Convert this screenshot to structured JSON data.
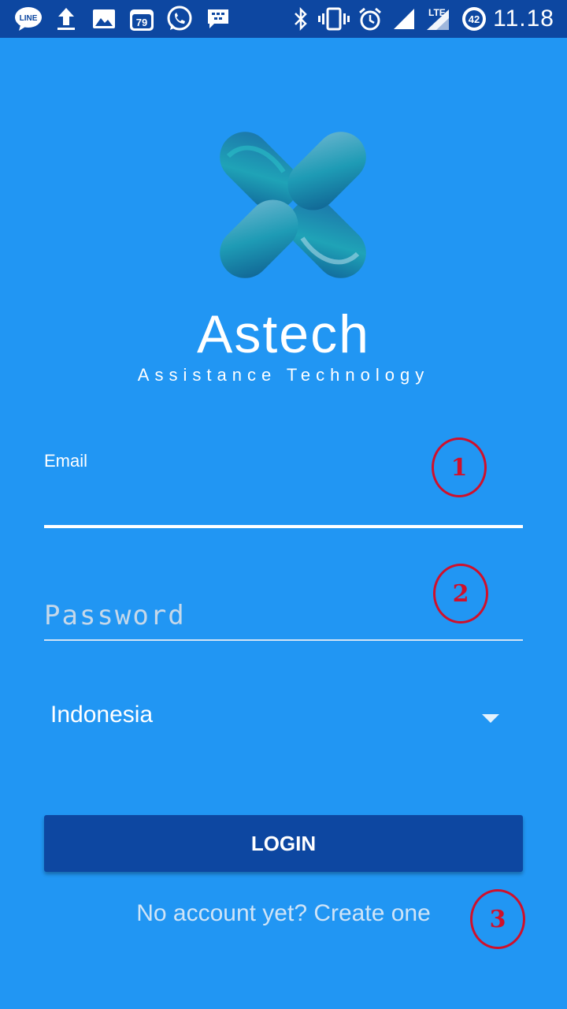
{
  "status_bar": {
    "time": "11.18",
    "battery_level": "42",
    "network": "LTE",
    "notification_badge": "79",
    "icons": [
      "line-icon",
      "upload-icon",
      "image-icon",
      "calendar-icon",
      "whatsapp-icon",
      "bbm-icon",
      "bluetooth-icon",
      "vibrate-icon",
      "alarm-icon",
      "signal-icon",
      "lte-signal-icon",
      "battery-icon"
    ]
  },
  "app": {
    "title": "Astech",
    "subtitle": "Assistance Technology"
  },
  "form": {
    "email_label": "Email",
    "email_value": "",
    "password_placeholder": "Password",
    "country_selected": "Indonesia",
    "login_label": "LOGIN",
    "signup_text": "No account yet? Create one"
  },
  "annotations": [
    "1",
    "2",
    "3"
  ],
  "colors": {
    "background": "#2196F3",
    "status_bar": "#0D47A1",
    "button": "#0D47A1",
    "annotation": "#D0102B"
  }
}
